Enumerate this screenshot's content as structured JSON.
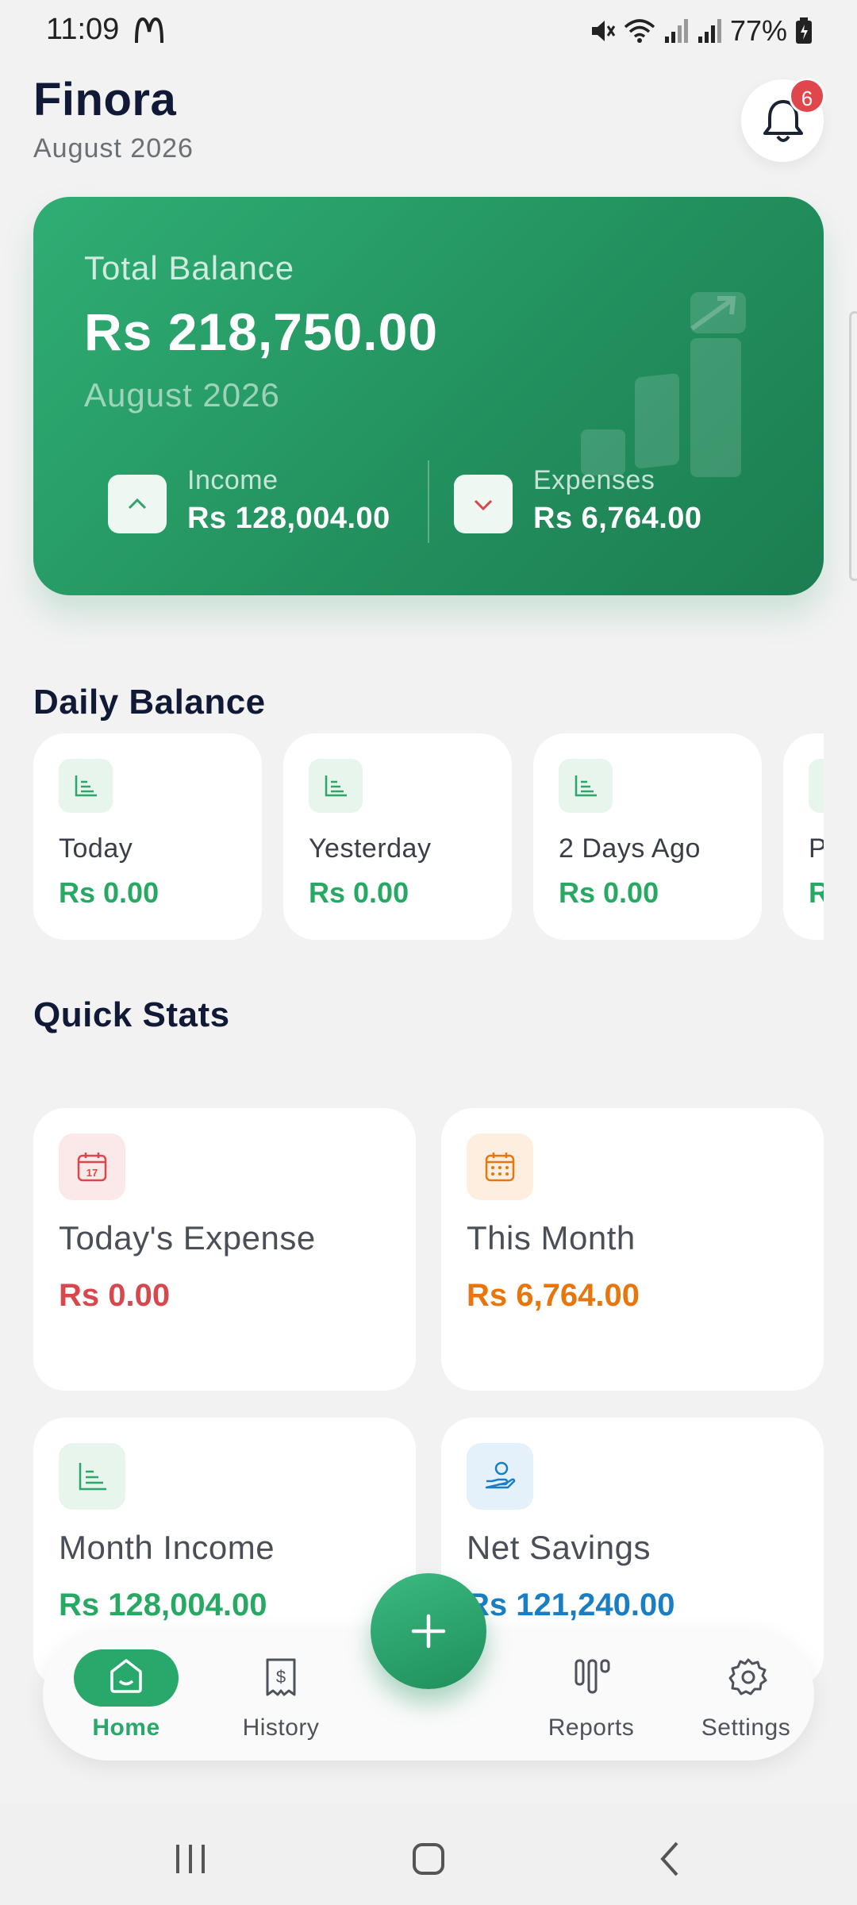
{
  "status_bar": {
    "time": "11:09",
    "battery_percent": "77%",
    "icons": [
      "mcdonalds-icon",
      "mute-icon",
      "wifi-icon",
      "signal-icon",
      "signal-icon",
      "battery-icon"
    ]
  },
  "header": {
    "title": "Finora",
    "subtitle": "August 2026",
    "notification_count": "6"
  },
  "balance_card": {
    "label": "Total Balance",
    "amount": "Rs 218,750.00",
    "month": "August 2026",
    "income_label": "Income",
    "income_value": "Rs 128,004.00",
    "expenses_label": "Expenses",
    "expenses_value": "Rs 6,764.00"
  },
  "daily_balance": {
    "title": "Daily Balance",
    "items": [
      {
        "label": "Today",
        "value": "Rs 0.00"
      },
      {
        "label": "Yesterday",
        "value": "Rs 0.00"
      },
      {
        "label": "2 Days Ago",
        "value": "Rs 0.00"
      },
      {
        "label": "P",
        "value": "R"
      }
    ]
  },
  "quick_stats": {
    "title": "Quick Stats",
    "items": [
      {
        "label": "Today's Expense",
        "value": "Rs 0.00",
        "color": "#d8474c",
        "icon": "calendar-day-icon"
      },
      {
        "label": "This Month",
        "value": "Rs 6,764.00",
        "color": "#e8760c",
        "icon": "calendar-month-icon"
      },
      {
        "label": "Month Income",
        "value": "Rs 128,004.00",
        "color": "#27a964",
        "icon": "chart-icon"
      },
      {
        "label": "Net Savings",
        "value": "Rs 121,240.00",
        "color": "#1a7ec4",
        "icon": "hand-coin-icon"
      }
    ]
  },
  "bottom_nav": {
    "items": [
      {
        "label": "Home",
        "active": true
      },
      {
        "label": "History",
        "active": false
      },
      {
        "label": "Reports",
        "active": false
      },
      {
        "label": "Settings",
        "active": false
      }
    ]
  },
  "colors": {
    "brand": "#28a86a",
    "expense": "#d8474c",
    "month": "#e8760c",
    "savings": "#1a7ec4"
  }
}
